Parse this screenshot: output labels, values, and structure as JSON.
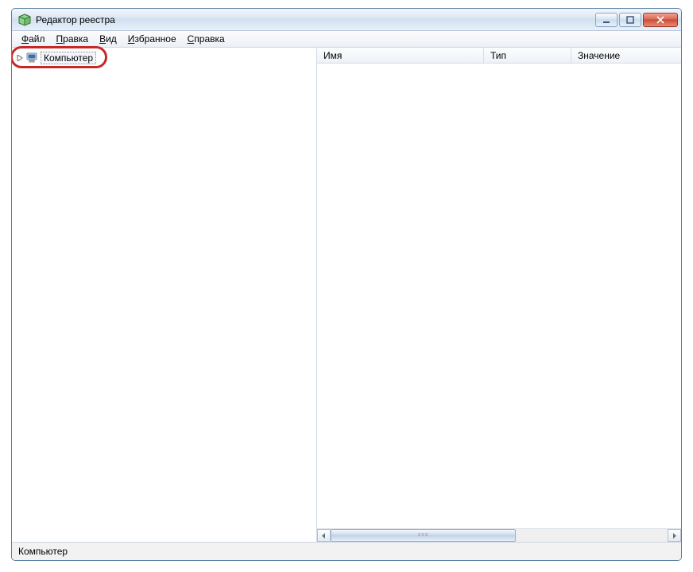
{
  "window": {
    "title": "Редактор реестра"
  },
  "menu": {
    "file": "Файл",
    "edit": "Правка",
    "view": "Вид",
    "favorites": "Избранное",
    "help": "Справка"
  },
  "tree": {
    "root_label": "Компьютер"
  },
  "list": {
    "columns": {
      "name": "Имя",
      "type": "Тип",
      "value": "Значение"
    }
  },
  "status": {
    "text": "Компьютер"
  },
  "icons": {
    "app": "regedit-cube-icon",
    "computer": "computer-icon",
    "expander": "triangle-right-icon",
    "minimize": "minimize-icon",
    "maximize": "maximize-icon",
    "close": "close-icon",
    "scroll_left": "chevron-left-icon",
    "scroll_right": "chevron-right-icon"
  }
}
